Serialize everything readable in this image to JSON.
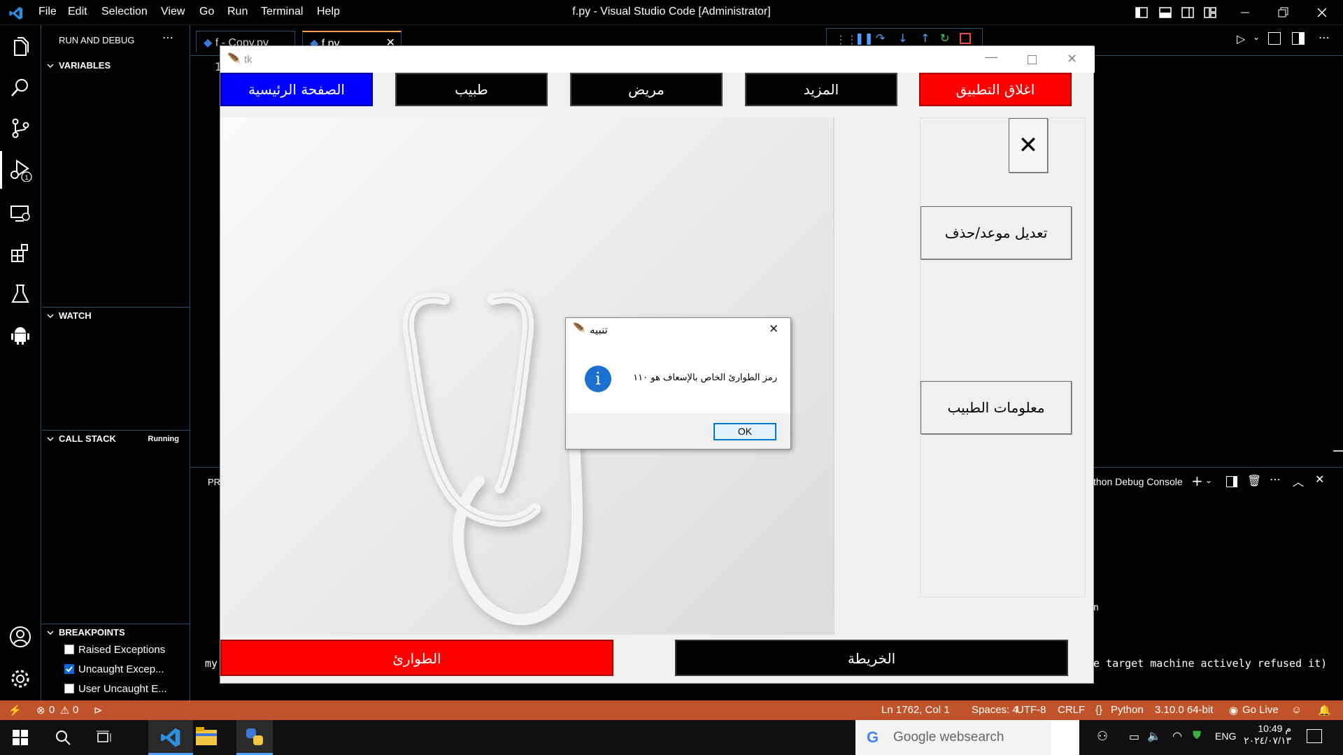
{
  "window_title": "f.py - Visual Studio Code [Administrator]",
  "menu": [
    "File",
    "Edit",
    "Selection",
    "View",
    "Go",
    "Run",
    "Terminal",
    "Help"
  ],
  "sidebar": {
    "title": "RUN AND DEBUG",
    "sections": {
      "variables": "VARIABLES",
      "watch": "WATCH",
      "call_stack": "CALL STACK",
      "call_stack_status": "Running",
      "breakpoints": "BREAKPOINTS"
    },
    "breakpoints": [
      {
        "label": "Raised Exceptions",
        "checked": false
      },
      {
        "label": "Uncaught Excep...",
        "checked": true
      },
      {
        "label": "User Uncaught E...",
        "checked": false
      }
    ]
  },
  "tabs": [
    {
      "label": "f - Copy.py"
    },
    {
      "label": "f.py"
    }
  ],
  "editor_line_fragment": "1",
  "panel": {
    "tab_fragment": "PR",
    "console_label": "thon Debug Console",
    "terminal_fragment_left": "my",
    "terminal_fragment_right": "e target machine actively refused it)",
    "terminal_fragment_mid": "n"
  },
  "tk": {
    "title": "tk",
    "nav_buttons": [
      {
        "label": "الصفحة الرئيسية",
        "color": "#0000ff"
      },
      {
        "label": "طبيب",
        "color": "#000000"
      },
      {
        "label": "مريض",
        "color": "#000000"
      },
      {
        "label": "المزيد",
        "color": "#000000"
      },
      {
        "label": "اغلاق التطبيق",
        "color": "#ff0000"
      }
    ],
    "close_symbol": "✕",
    "side_buttons": [
      "تعديل موعد/حذف",
      "معلومات الطبيب"
    ],
    "bottom_buttons": [
      {
        "label": "الطوارئ",
        "color": "#ff0000"
      },
      {
        "label": "الخريطة",
        "color": "#000000"
      }
    ]
  },
  "dialog": {
    "title": "تنبيه",
    "message": "رمز الطوارئ الخاص بالإسعاف هو ١١٠",
    "ok": "OK"
  },
  "statusbar": {
    "errors": "0",
    "warnings": "0",
    "position": "Ln 1762, Col 1",
    "spaces": "Spaces: 4",
    "encoding": "UTF-8",
    "eol": "CRLF",
    "language": "Python",
    "interpreter": "3.10.0 64-bit",
    "golive": "Go Live"
  },
  "taskbar": {
    "search_placeholder": "Google websearch",
    "lang": "ENG",
    "time": "10:49 م",
    "date": "٢٠٢٤/٠٧/١٣"
  }
}
